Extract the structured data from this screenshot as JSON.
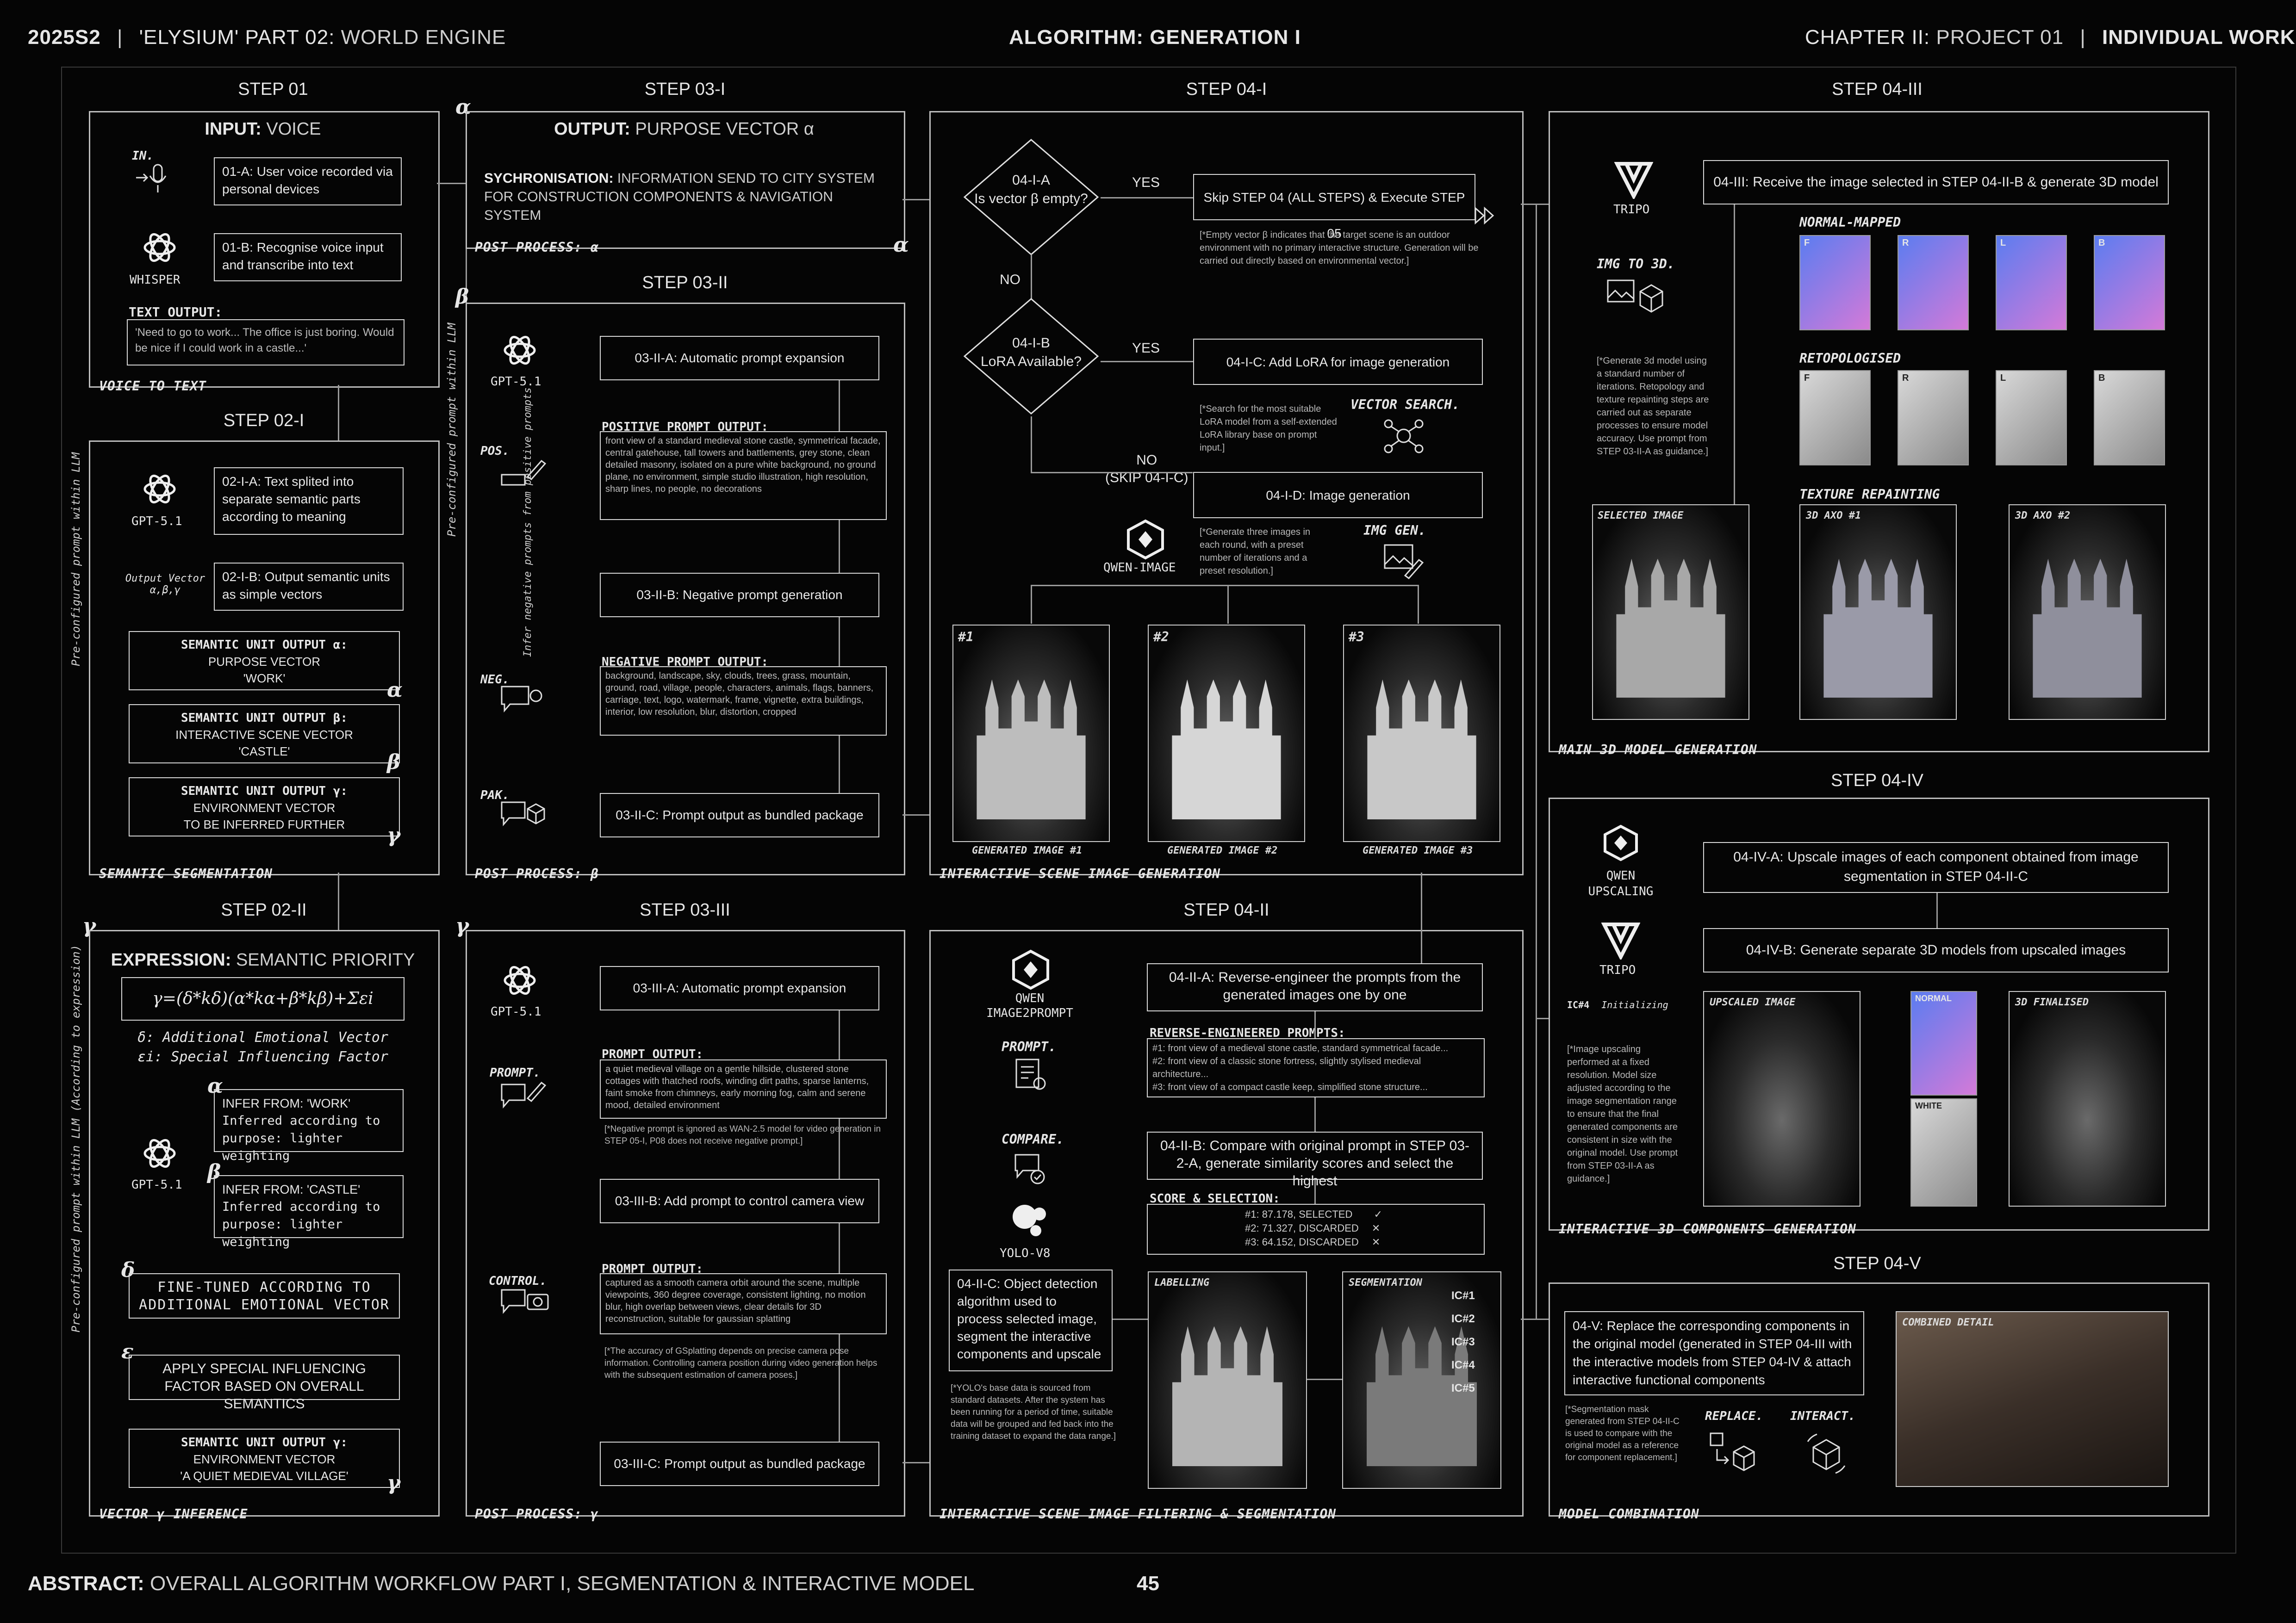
{
  "header": {
    "left_code": "2025S2",
    "left_sep": "|",
    "left_project": "'ELYSIUM' PART 02:",
    "left_subtitle": "WORLD ENGINE",
    "center_label": "ALGORITHM:",
    "center_value": "GENERATION I",
    "right_chapter": "CHAPTER II:",
    "right_project": "PROJECT 01",
    "right_sep": "|",
    "right_work": "INDIVIDUAL WORK"
  },
  "footer": {
    "abstract_label": "ABSTRACT:",
    "abstract_text": "OVERALL ALGORITHM WORKFLOW PART I, SEGMENTATION & INTERACTIVE MODEL",
    "page_number": "45"
  },
  "steps": {
    "s01": "STEP 01",
    "s02i": "STEP 02-I",
    "s02ii": "STEP 02-II",
    "s03i": "STEP 03-I",
    "s03ii": "STEP 03-II",
    "s03iii": "STEP 03-III",
    "s04i": "STEP 04-I",
    "s04ii": "STEP 04-II",
    "s04iii": "STEP 04-III",
    "s04iv": "STEP 04-IV",
    "s04v": "STEP 04-V"
  },
  "step01": {
    "title_bold": "INPUT:",
    "title_thin": "VOICE",
    "in_label": "IN.",
    "whisper_label": "WHISPER",
    "box_a": "01-A: User voice recorded via personal devices",
    "box_b": "01-B: Recognise voice input and transcribe into text",
    "text_output_label": "TEXT OUTPUT:",
    "text_output": "'Need to go to work... The office is just boring. Would be nice if I could work in a castle...'",
    "caption": "VOICE TO TEXT"
  },
  "step02i": {
    "gpt_label": "GPT-5.1",
    "box_a": "02-I-A: Text splited into separate semantic parts according to meaning",
    "box_b": "02-I-B: Output semantic units as simple vectors",
    "output_vector_label": "Output Vector",
    "output_vector_sub": "α,β,γ",
    "unit_alpha_title": "SEMANTIC UNIT OUTPUT α:",
    "unit_alpha_l1": "PURPOSE VECTOR",
    "unit_alpha_l2": "'WORK'",
    "unit_beta_title": "SEMANTIC UNIT OUTPUT β:",
    "unit_beta_l1": "INTERACTIVE SCENE VECTOR",
    "unit_beta_l2": "'CASTLE'",
    "unit_gamma_title": "SEMANTIC UNIT OUTPUT γ:",
    "unit_gamma_l1": "ENVIRONMENT VECTOR",
    "unit_gamma_l2": "TO BE INFERRED FURTHER",
    "caption": "SEMANTIC SEGMENTATION",
    "side_text": "Pre-configured prompt within LLM"
  },
  "step02ii": {
    "title_bold": "EXPRESSION:",
    "title_thin": "SEMANTIC PRIORITY",
    "formula": "γ=(δ*kδ)(α*kα+β*kβ)+Σεi",
    "delta_def": "δ: Additional Emotional Vector",
    "eps_def": "εi: Special Influencing Factor",
    "gpt_label": "GPT-5.1",
    "infer_work_1": "INFER FROM: 'WORK'",
    "infer_work_2": "Inferred according to purpose: lighter weighting",
    "infer_castle_1": "INFER FROM: 'CASTLE'",
    "infer_castle_2": "Inferred according to purpose: lighter weighting",
    "finetune": "FINE-TUNED ACCORDING TO ADDITIONAL EMOTIONAL VECTOR",
    "special": "APPLY SPECIAL INFLUENCING FACTOR BASED ON OVERALL SEMANTICS",
    "unit_gamma_title": "SEMANTIC UNIT OUTPUT γ:",
    "unit_gamma_l1": "ENVIRONMENT VECTOR",
    "unit_gamma_l2": "'A QUIET MEDIEVAL VILLAGE'",
    "caption": "VECTOR γ INFERENCE",
    "side_text": "Pre-configured prompt within LLM (According to expression)"
  },
  "step03i": {
    "title_bold": "OUTPUT:",
    "title_thin": "PURPOSE VECTOR α",
    "sync_bold": "SYCHRONISATION:",
    "sync_text": "INFORMATION SEND TO CITY SYSTEM FOR CONSTRUCTION COMPONENTS & NAVIGATION SYSTEM",
    "caption": "POST PROCESS: α"
  },
  "step03ii": {
    "gpt_label": "GPT-5.1",
    "pos_label": "POS.",
    "neg_label": "NEG.",
    "pak_label": "PAK.",
    "box_a": "03-II-A: Automatic prompt expansion",
    "pos_title": "POSITIVE PROMPT OUTPUT:",
    "pos_text": "front view of a standard medieval stone castle, symmetrical facade, central gatehouse, tall towers and battlements, grey stone, clean detailed masonry, isolated on a pure white background, no ground plane, no environment, simple studio illustration, high resolution, sharp lines, no people, no decorations",
    "box_b": "03-II-B: Negative prompt generation",
    "neg_title": "NEGATIVE PROMPT OUTPUT:",
    "neg_text": "background, landscape, sky, clouds, trees, grass, mountain, ground, road, village, people, characters, animals, flags, banners, carriage, text, logo, watermark, frame, vignette, extra buildings, interior, low resolution, blur, distortion, cropped",
    "box_c": "03-II-C: Prompt output as bundled package",
    "side_text": "Infer negative prompts from positive prompts",
    "side_side": "Pre-configured prompt within LLM",
    "caption": "POST PROCESS: β"
  },
  "step03iii": {
    "gpt_label": "GPT-5.1",
    "prompt_label": "PROMPT.",
    "control_label": "CONTROL.",
    "box_a": "03-III-A: Automatic prompt expansion",
    "prompt_title": "PROMPT OUTPUT:",
    "prompt_text": "a quiet medieval village on a gentle hillside, clustered stone cottages with thatched roofs, winding dirt paths, sparse lanterns, faint smoke from chimneys, early morning fog, calm and serene mood, detailed environment",
    "note_1": "[*Negative prompt is ignored as WAN-2.5 model for video generation in STEP 05-I, P08 does not receive negative prompt.]",
    "box_b": "03-III-B: Add prompt to control camera view",
    "prompt2_title": "PROMPT OUTPUT:",
    "prompt2_text": "captured as a smooth camera orbit around the scene, multiple viewpoints, 360 degree coverage, consistent lighting, no motion blur, high overlap between views, clear details for 3D reconstruction, suitable for gaussian splatting",
    "note_2": "[*The accuracy of GSplatting depends on precise camera pose information. Controlling camera position during video generation helps with the subsequent estimation of camera poses.]",
    "box_c": "03-III-C: Prompt output as bundled package",
    "caption": "POST PROCESS: γ"
  },
  "step04i": {
    "dec_a_1": "04-I-A",
    "dec_a_2": "Is vector β empty?",
    "yes_1": "YES",
    "no_1": "NO",
    "skip_box": "Skip STEP 04 (ALL STEPS) & Execute STEP 05",
    "skip_note": "[*Empty vector β indicates that the target scene is an outdoor environment with no primary interactive structure. Generation will be carried out directly based on environmental vector.]",
    "dec_b_1": "04-I-B",
    "dec_b_2": "LoRA Available?",
    "yes_2": "YES",
    "no_2": "NO",
    "no_2_sub": "(SKIP 04-I-C)",
    "box_c": "04-I-C: Add LoRA for image generation",
    "lora_note": "[*Search for the most suitable LoRA model from a self-extended LoRA library base on prompt input.]",
    "vector_search": "VECTOR SEARCH.",
    "box_d": "04-I-D: Image generation",
    "qwen_image": "QWEN-IMAGE",
    "gen_note": "[*Generate three images in each round, with a preset number of iterations and a preset resolution.]",
    "img_gen": "IMG GEN.",
    "img1_tag": "#1",
    "img2_tag": "#2",
    "img3_tag": "#3",
    "img1_cap": "GENERATED IMAGE #1",
    "img2_cap": "GENERATED IMAGE #2",
    "img3_cap": "GENERATED IMAGE #3",
    "caption": "INTERACTIVE SCENE IMAGE GENERATION"
  },
  "step04ii": {
    "qwen_label": "QWEN IMAGE2PROMPT",
    "prompt_label": "PROMPT.",
    "compare_label": "COMPARE.",
    "yolo_label": "YOLO-V8",
    "box_a": "04-II-A: Reverse-engineer the prompts from the generated images one by one",
    "rev_title": "REVERSE-ENGINEERED PROMPTS:",
    "rev_1": "#1: front view of a medieval stone castle, standard symmetrical facade...",
    "rev_2": "#2: front view of a classic stone fortress, slightly stylised medieval architecture...",
    "rev_3": "#3: front view of a compact castle keep, simplified stone structure...",
    "box_b": "04-II-B: Compare with original prompt in STEP 03-2-A, generate similarity scores and select the highest",
    "score_title": "SCORE & SELECTION:",
    "score_1": "#1: 87.178, SELECTED",
    "score_2": "#2: 71.327, DISCARDED",
    "score_3": "#3: 64.152, DISCARDED",
    "box_c": "04-II-C: Object detection algorithm used to process selected image, segment the interactive components and upscale",
    "yolo_note": "[*YOLO's base data is sourced from standard datasets. After the system has been running for a period of time, suitable data will be grouped and fed back into the training dataset to expand the data range.]",
    "labelling": "LABELLING",
    "segmentation": "SEGMENTATION",
    "ic1": "IC#1",
    "ic2": "IC#2",
    "ic3": "IC#3",
    "ic4": "IC#4",
    "ic5": "IC#5",
    "caption": "INTERACTIVE SCENE IMAGE FILTERING & SEGMENTATION"
  },
  "step04iii": {
    "tripo_label": "TRIPO",
    "img3d_label": "IMG TO 3D.",
    "box": "04-III: Receive the image selected in STEP 04-II-B & generate 3D model",
    "normal_title": "NORMAL-MAPPED",
    "retop_title": "RETOPOLOGISED",
    "texture_title": "TEXTURE REPAINTING",
    "views": [
      "F",
      "R",
      "L",
      "B"
    ],
    "note": "[*Generate 3d model using a standard number of iterations. Retopology and texture repainting steps are carried out as separate processes to ensure model accuracy. Use prompt from STEP 03-II-A as guidance.]",
    "selected_label": "SELECTED IMAGE",
    "axo1_label": "3D AXO #1",
    "axo2_label": "3D AXO #2",
    "caption": "MAIN 3D MODEL GENERATION"
  },
  "step04iv": {
    "qwen_label": "QWEN UPSCALING",
    "tripo_label": "TRIPO",
    "box_a": "04-IV-A: Upscale images of each component obtained from image segmentation in STEP 04-II-C",
    "box_b": "04-IV-B: Generate separate 3D models from upscaled images",
    "ic_stack": "IC#4",
    "initializing": "Initializing",
    "note": "[*Image upscaling performed at a fixed resolution. Model size adjusted according to the image segmentation range to ensure that the final generated components are consistent in size with the original model. Use prompt from STEP 03-II-A as guidance.]",
    "upscaled_label": "UPSCALED IMAGE",
    "normal_label": "NORMAL",
    "white_label": "WHITE",
    "finalised_label": "3D FINALISED",
    "caption": "INTERACTIVE 3D COMPONENTS GENERATION"
  },
  "step04v": {
    "box": "04-V: Replace the corresponding components in the original model (generated in STEP 04-III with the interactive models from STEP 04-IV & attach interactive functional components",
    "note": "[*Segmentation mask generated from STEP 04-II-C is used to compare with the original model as a reference for component replacement.]",
    "replace_label": "REPLACE.",
    "interact_label": "INTERACT.",
    "combined_label": "COMBINED DETAIL",
    "caption": "MODEL COMBINATION"
  },
  "greek": {
    "alpha": "α",
    "beta": "β",
    "gamma": "γ",
    "delta": "δ",
    "epsilon": "ε"
  },
  "icons": [
    "microphone-icon",
    "openai-icon",
    "tripo-icon",
    "qwen-icon",
    "yolo-icon",
    "vector-search-icon",
    "img-gen-icon",
    "pen-icon",
    "chat-icon",
    "package-icon",
    "camera-icon",
    "compare-icon",
    "cube-icon"
  ],
  "colors": {
    "background": "#050505",
    "line": "#d8d8d8",
    "text": "#e6e6e6",
    "normal_map": "#6f7df0"
  }
}
